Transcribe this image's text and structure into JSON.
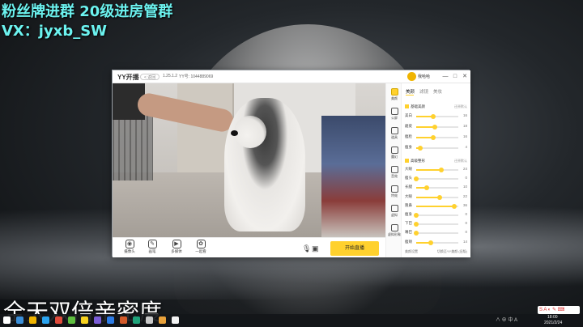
{
  "overlay": {
    "line1": "粉丝牌进群 20级进房管群",
    "line2": "VX：jyxb_SW",
    "bottom": "全天双倍亲密度"
  },
  "app": {
    "logo": "YY开播",
    "back_label": "< 返回",
    "version": "1.25.1.2",
    "yy_id": "YY号: 1044889069",
    "username": "我哈哈",
    "window_buttons": [
      "—",
      "□",
      "✕"
    ]
  },
  "controls": {
    "tools": [
      {
        "icon": "camera-icon",
        "label": "摄像头"
      },
      {
        "icon": "pen-icon",
        "label": "画笔"
      },
      {
        "icon": "media-icon",
        "label": "多媒体"
      },
      {
        "icon": "together-icon",
        "label": "一起看"
      }
    ],
    "live_button": "开始直播"
  },
  "rail": {
    "items": [
      "美颜",
      "公屏",
      "道具",
      "魔幻",
      "音效",
      "特效",
      "虚拟",
      "虚拟形象"
    ]
  },
  "panel": {
    "tabs": [
      "美颜",
      "滤镜",
      "美妆"
    ],
    "section1": {
      "title": "基础美颜",
      "reset": "还原默认"
    },
    "basic": [
      {
        "name": "美白",
        "value": 16
      },
      {
        "name": "磨皮",
        "value": 18
      },
      {
        "name": "瘦脸",
        "value": 16
      },
      {
        "name": "瘦身",
        "value": 4
      }
    ],
    "section2": {
      "title": "高级整形",
      "reset": "还原默认"
    },
    "advanced": [
      {
        "name": "大眼",
        "value": 24
      },
      {
        "name": "瘦头",
        "value": 0
      },
      {
        "name": "长腿",
        "value": 10
      },
      {
        "name": "大眼",
        "value": 22
      },
      {
        "name": "隆鼻",
        "value": 36
      },
      {
        "name": "瘦身",
        "value": 0
      },
      {
        "name": "下巴",
        "value": 0
      },
      {
        "name": "嘴巴",
        "value": 0
      },
      {
        "name": "瘦颊",
        "value": 14
      }
    ],
    "footer_left": "美颜设置",
    "footer_right": "切换至YY美颜 (旧版)"
  },
  "taskbar": {
    "tray": "∧ ⊕ 中 A",
    "time": "18:00",
    "date": "2021/2/24",
    "ime": "S A ◐ ✎ ⌨"
  }
}
